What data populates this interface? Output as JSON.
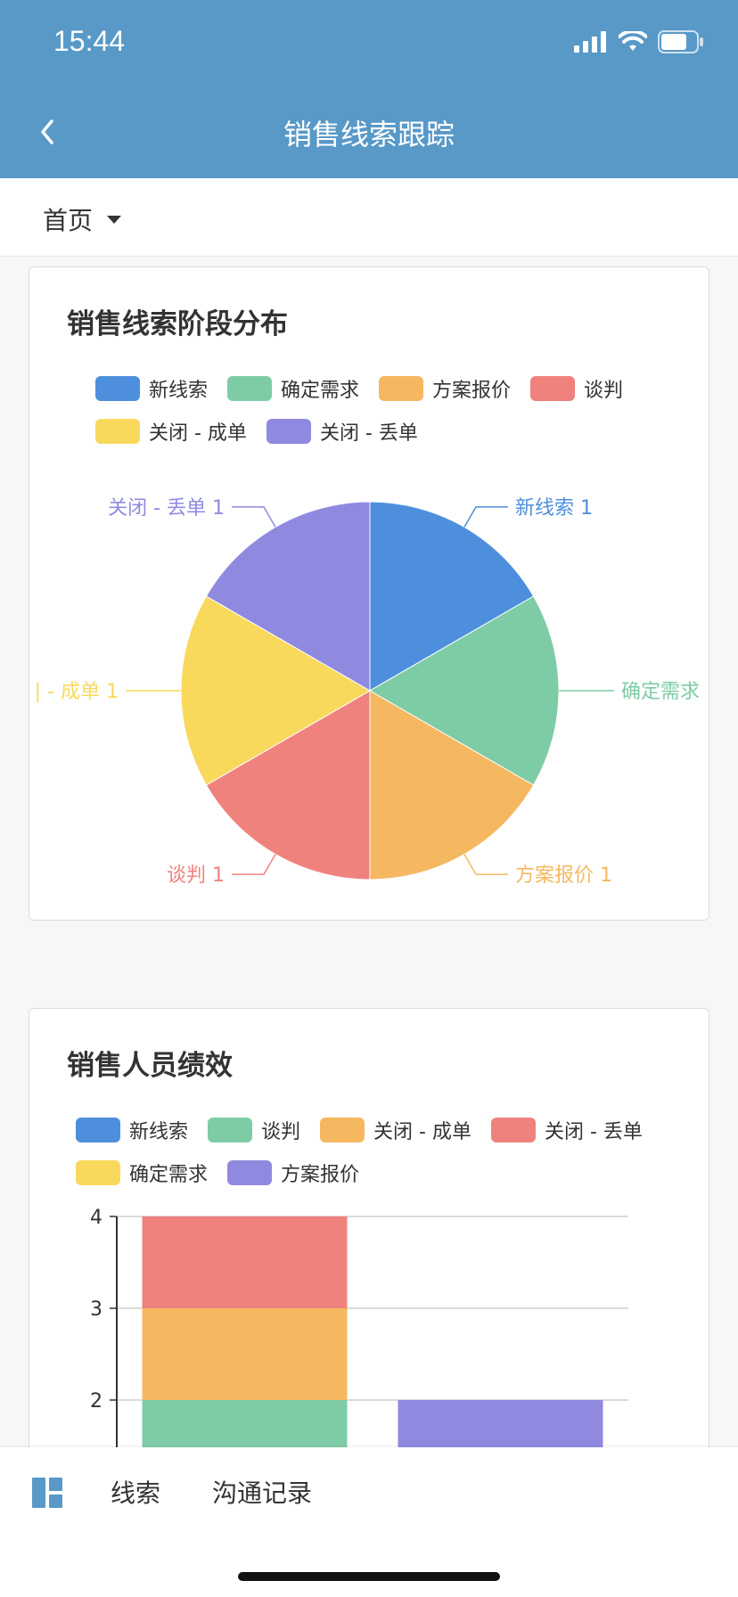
{
  "status": {
    "time": "15:44"
  },
  "nav": {
    "title": "销售线索跟踪"
  },
  "crumb": {
    "label": "首页"
  },
  "pie": {
    "title": "销售线索阶段分布",
    "legend": [
      {
        "label": "新线索",
        "color": "#4e8fdd"
      },
      {
        "label": "确定需求",
        "color": "#7ecca6"
      },
      {
        "label": "方案报价",
        "color": "#f5b861"
      },
      {
        "label": "谈判",
        "color": "#f0827e"
      },
      {
        "label": "关闭 - 成单",
        "color": "#f9d95c"
      },
      {
        "label": "关闭 - 丢单",
        "color": "#8f8ae0"
      }
    ],
    "labels": [
      "新线索 1",
      "确定需求",
      "方案报价 1",
      "谈判 1",
      "| - 成单 1",
      "关闭 - 丢单 1"
    ]
  },
  "bar": {
    "title": "销售人员绩效",
    "legend": [
      {
        "label": "新线索",
        "color": "#4e8fdd"
      },
      {
        "label": "谈判",
        "color": "#7ecca6"
      },
      {
        "label": "关闭 - 成单",
        "color": "#f5b861"
      },
      {
        "label": "关闭 - 丢单",
        "color": "#f0827e"
      },
      {
        "label": "确定需求",
        "color": "#f9d95c"
      },
      {
        "label": "方案报价",
        "color": "#8f8ae0"
      }
    ]
  },
  "tabs": {
    "lead": "线索",
    "comm": "沟通记录"
  },
  "chart_data": [
    {
      "type": "pie",
      "title": "销售线索阶段分布",
      "categories": [
        "新线索",
        "确定需求",
        "方案报价",
        "谈判",
        "关闭 - 成单",
        "关闭 - 丢单"
      ],
      "values": [
        1,
        1,
        1,
        1,
        1,
        1
      ],
      "colors": [
        "#4e8fdd",
        "#7ecca6",
        "#f5b861",
        "#f0827e",
        "#f9d95c",
        "#8f8ae0"
      ],
      "legend": "top"
    },
    {
      "type": "bar",
      "title": "销售人员绩效",
      "stacked": true,
      "categories": [
        "",
        ""
      ],
      "series": [
        {
          "name": "谈判",
          "color": "#7ecca6",
          "values": [
            2,
            0
          ]
        },
        {
          "name": "关闭 - 成单",
          "color": "#f5b861",
          "values": [
            1,
            0
          ]
        },
        {
          "name": "关闭 - 丢单",
          "color": "#f0827e",
          "values": [
            1,
            0
          ]
        },
        {
          "name": "方案报价",
          "color": "#8f8ae0",
          "values": [
            0,
            2
          ]
        }
      ],
      "yticks": [
        "2",
        "3",
        "4"
      ],
      "ylim": [
        0,
        4
      ],
      "grid": true,
      "legend": "top"
    }
  ]
}
